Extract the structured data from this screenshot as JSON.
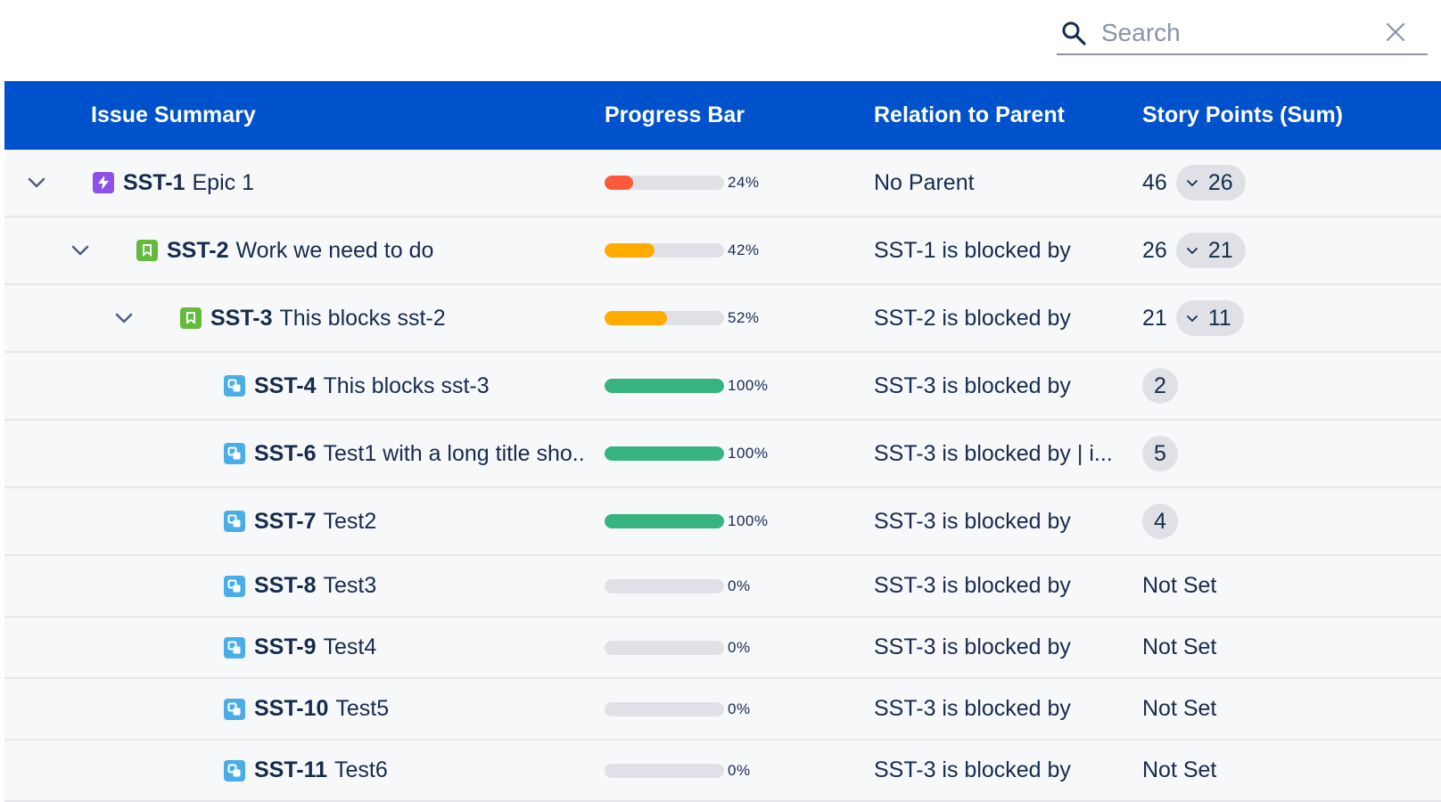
{
  "search": {
    "placeholder": "Search",
    "value": ""
  },
  "columns": [
    "Issue Summary",
    "Progress Bar",
    "Relation to Parent",
    "Story Points (Sum)"
  ],
  "colors": {
    "header_bg": "#0052cc",
    "epic": "#8d50e8",
    "story": "#63ba3c",
    "subtask": "#4bade8",
    "progress_low": "#fa5a37",
    "progress_mid": "#ffab00",
    "progress_done": "#36b37e"
  },
  "rows": [
    {
      "key": "SST-1",
      "title": "Epic 1",
      "type": "epic",
      "icon": "lightning-icon",
      "expandable": true,
      "progress": 24,
      "progress_label": "24%",
      "progress_color": "#fa5a37",
      "relation": "No Parent",
      "sp_total": "46",
      "sp_child": "26"
    },
    {
      "key": "SST-2",
      "title": "Work we need to do",
      "type": "story",
      "icon": "bookmark-icon",
      "expandable": true,
      "progress": 42,
      "progress_label": "42%",
      "progress_color": "#ffab00",
      "relation": "SST-1 is blocked by",
      "sp_total": "26",
      "sp_child": "21"
    },
    {
      "key": "SST-3",
      "title": "This blocks sst-2",
      "type": "story",
      "icon": "bookmark-icon",
      "expandable": true,
      "progress": 52,
      "progress_label": "52%",
      "progress_color": "#ffab00",
      "relation": "SST-2 is blocked by",
      "sp_total": "21",
      "sp_child": "11"
    },
    {
      "key": "SST-4",
      "title": "This blocks sst-3",
      "type": "subtask",
      "icon": "subtask-icon",
      "expandable": false,
      "progress": 100,
      "progress_label": "100%",
      "progress_color": "#36b37e",
      "relation": "SST-3 is blocked by",
      "sp_badge": "2"
    },
    {
      "key": "SST-6",
      "title": "Test1 with a long title sho..",
      "type": "subtask",
      "icon": "subtask-icon",
      "expandable": false,
      "progress": 100,
      "progress_label": "100%",
      "progress_color": "#36b37e",
      "relation": "SST-3 is blocked by | i...",
      "sp_badge": "5"
    },
    {
      "key": "SST-7",
      "title": "Test2",
      "type": "subtask",
      "icon": "subtask-icon",
      "expandable": false,
      "progress": 100,
      "progress_label": "100%",
      "progress_color": "#36b37e",
      "relation": "SST-3 is blocked by",
      "sp_badge": "4"
    },
    {
      "key": "SST-8",
      "title": "Test3",
      "type": "subtask",
      "icon": "subtask-icon",
      "expandable": false,
      "progress": 0,
      "progress_label": "0%",
      "progress_color": "#36b37e",
      "relation": "SST-3 is blocked by",
      "sp_text": "Not Set"
    },
    {
      "key": "SST-9",
      "title": "Test4",
      "type": "subtask",
      "icon": "subtask-icon",
      "expandable": false,
      "progress": 0,
      "progress_label": "0%",
      "progress_color": "#36b37e",
      "relation": "SST-3 is blocked by",
      "sp_text": "Not Set"
    },
    {
      "key": "SST-10",
      "title": "Test5",
      "type": "subtask",
      "icon": "subtask-icon",
      "expandable": false,
      "progress": 0,
      "progress_label": "0%",
      "progress_color": "#36b37e",
      "relation": "SST-3 is blocked by",
      "sp_text": "Not Set"
    },
    {
      "key": "SST-11",
      "title": "Test6",
      "type": "subtask",
      "icon": "subtask-icon",
      "expandable": false,
      "progress": 0,
      "progress_label": "0%",
      "progress_color": "#36b37e",
      "relation": "SST-3 is blocked by",
      "sp_text": "Not Set"
    }
  ]
}
